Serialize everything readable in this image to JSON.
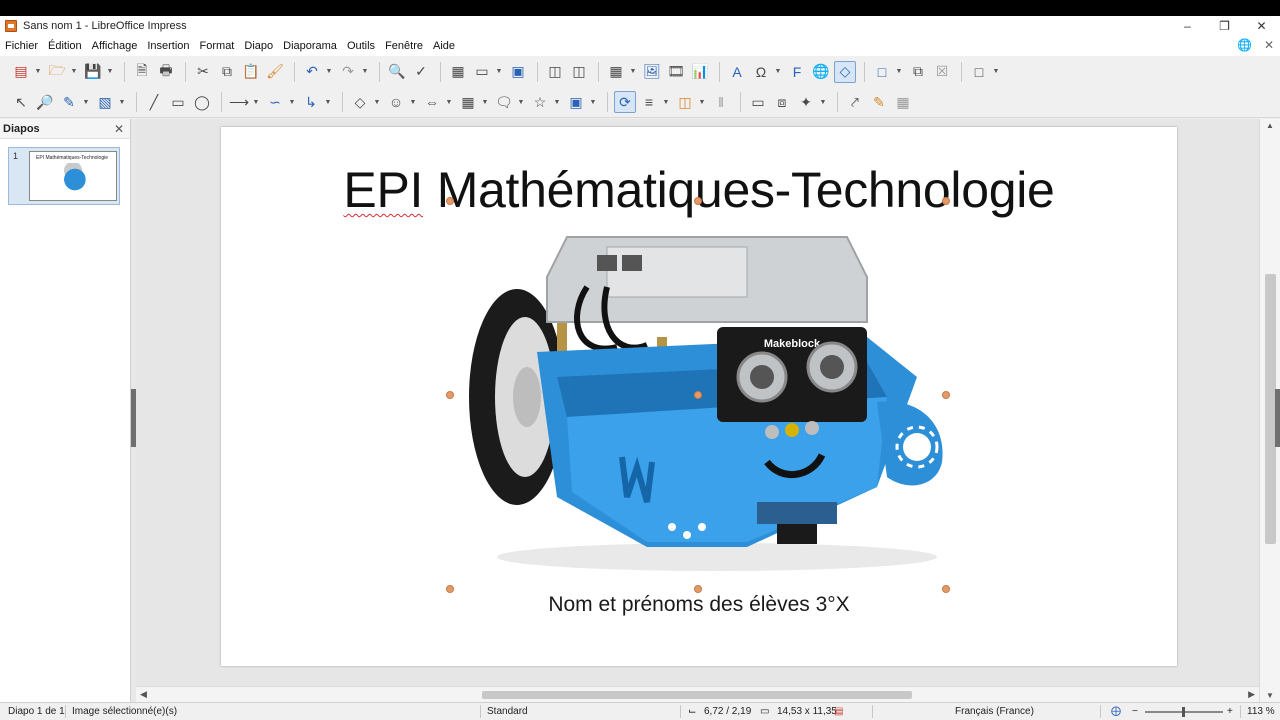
{
  "window": {
    "title": "Sans nom 1 - LibreOffice Impress",
    "controls": [
      "–",
      "❐",
      "✕"
    ]
  },
  "menu": [
    "Fichier",
    "Édition",
    "Affichage",
    "Insertion",
    "Format",
    "Diapo",
    "Diaporama",
    "Outils",
    "Fenêtre",
    "Aide"
  ],
  "panel": {
    "title": "Diapos",
    "close": "✕",
    "slide_number": "1",
    "thumb_title": "EPI Mathématiques-Technologie"
  },
  "slide": {
    "title_word1": "EPI",
    "title_rest": " Mathématiques-Technologie",
    "subtitle": "Nom et prénoms des élèves 3°X",
    "image_label": "Makeblock"
  },
  "status": {
    "slide": "Diapo 1 de 1",
    "selection": "Image sélectionné(e)(s)",
    "layout": "Standard",
    "position": "6,72 / 2,19",
    "size": "14,53 x 11,35",
    "language": "Français (France)",
    "zoom_minus": "−",
    "zoom_plus": "+",
    "zoom": "113 %"
  },
  "colors": {
    "robot_blue": "#2d8fd8",
    "handle": "#e39a66",
    "accent": "#2a63b5"
  }
}
